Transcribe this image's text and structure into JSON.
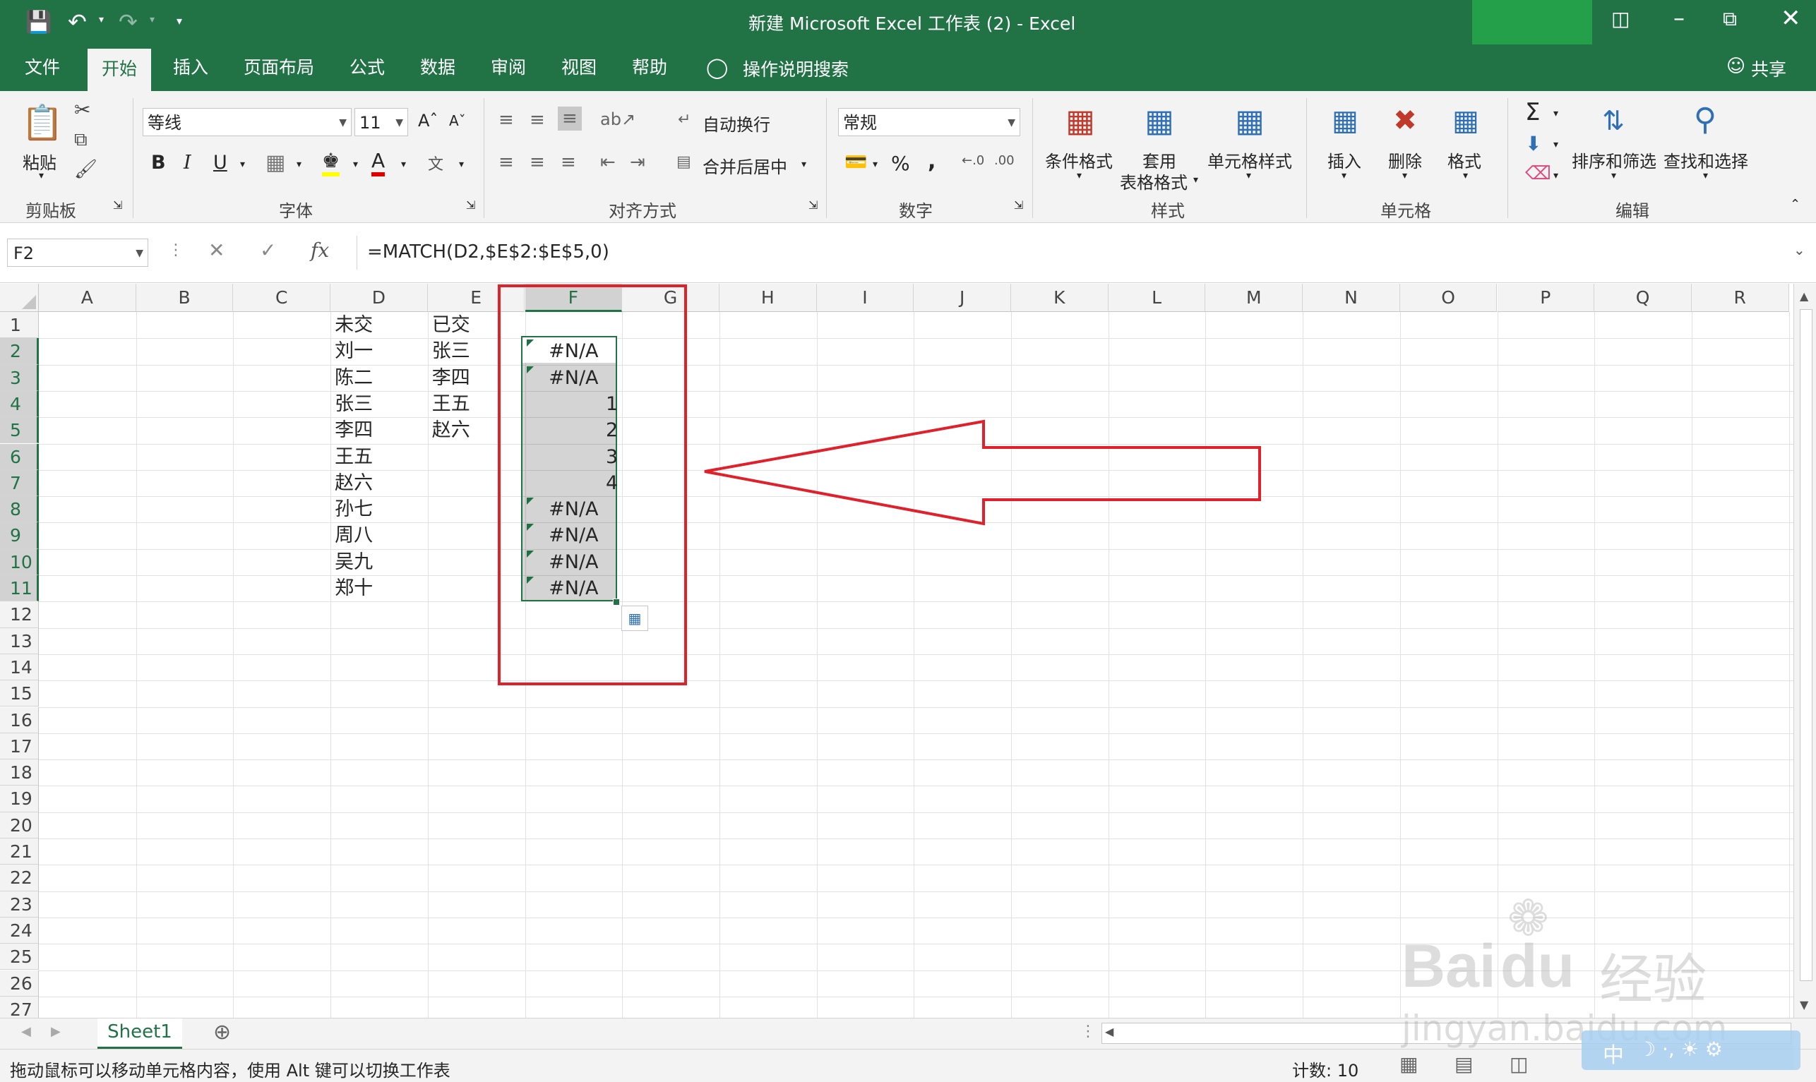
{
  "window": {
    "title": "新建 Microsoft Excel 工作表 (2)  -  Excel",
    "share_label": "共享",
    "accent": "#217346"
  },
  "tabs": [
    "文件",
    "开始",
    "插入",
    "页面布局",
    "公式",
    "数据",
    "审阅",
    "视图",
    "帮助"
  ],
  "tell_me": "操作说明搜索",
  "ribbon": {
    "clipboard": {
      "paste": "粘贴",
      "label": "剪贴板"
    },
    "font": {
      "name": "等线",
      "size": "11",
      "label": "字体",
      "bold": "B",
      "italic": "I",
      "underline": "U"
    },
    "alignment": {
      "wrap": "自动换行",
      "merge": "合并后居中",
      "label": "对齐方式"
    },
    "number": {
      "format": "常规",
      "label": "数字",
      "percent": "%",
      "comma": ","
    },
    "styles": {
      "conditional": "条件格式",
      "table_1": "套用",
      "table_2": "表格格式",
      "cell_styles": "单元格样式",
      "label": "样式"
    },
    "cells": {
      "insert": "插入",
      "delete": "删除",
      "format": "格式",
      "label": "单元格"
    },
    "editing": {
      "sort": "排序和筛选",
      "find": "查找和选择",
      "label": "编辑"
    }
  },
  "formula_bar": {
    "name_box": "F2",
    "fx": "fx",
    "formula": "=MATCH(D2,$E$2:$E$5,0)"
  },
  "columns": [
    "A",
    "B",
    "C",
    "D",
    "E",
    "F",
    "G",
    "H",
    "I",
    "J",
    "K",
    "L",
    "M",
    "N",
    "O",
    "P",
    "Q",
    "R"
  ],
  "rows": [
    "1",
    "2",
    "3",
    "4",
    "5",
    "6",
    "7",
    "8",
    "9",
    "10",
    "11",
    "12",
    "13",
    "14",
    "15",
    "16",
    "17",
    "18",
    "19",
    "20",
    "21",
    "22",
    "23",
    "24",
    "25",
    "26",
    "27"
  ],
  "cells": {
    "D": [
      "未交",
      "刘一",
      "陈二",
      "张三",
      "李四",
      "王五",
      "赵六",
      "孙七",
      "周八",
      "吴九",
      "郑十"
    ],
    "E": [
      "已交",
      "张三",
      "李四",
      "王五",
      "赵六"
    ],
    "F": [
      "",
      "#N/A",
      "#N/A",
      "1",
      "2",
      "3",
      "4",
      "#N/A",
      "#N/A",
      "#N/A",
      "#N/A"
    ]
  },
  "sheet_tabs": [
    "Sheet1"
  ],
  "status": {
    "message": "拖动鼠标可以移动单元格内容，使用 Alt 键可以切换工作表",
    "count": "计数: 10"
  },
  "watermark": {
    "brand": "Bai",
    "brand2": "du",
    "cn": "经验",
    "url": "jingyan.baidu.com",
    "ime": "中"
  }
}
